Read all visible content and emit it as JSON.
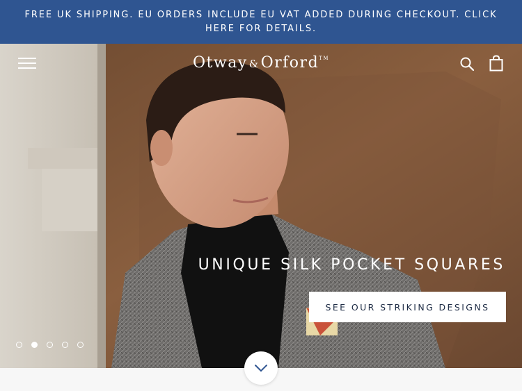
{
  "announcement": {
    "text": "Free UK shipping. EU orders include EU VAT added during checkout. Click here for details."
  },
  "header": {
    "logo": {
      "word1": "Otway",
      "amp": "&",
      "word2": "Orford",
      "tm": "TM"
    },
    "menu_icon": "hamburger-icon",
    "search_icon": "search-icon",
    "cart_icon": "shopping-bag-icon"
  },
  "hero": {
    "headline": "Unique silk pocket squares",
    "cta_label": "See our striking designs",
    "slides": {
      "count": 5,
      "active": 2
    }
  },
  "scroll_icon": "chevron-down-icon",
  "colors": {
    "announcement_bg": "#2f5591",
    "cta_text": "#1e2c45",
    "page_bg": "#f7f7f7"
  }
}
